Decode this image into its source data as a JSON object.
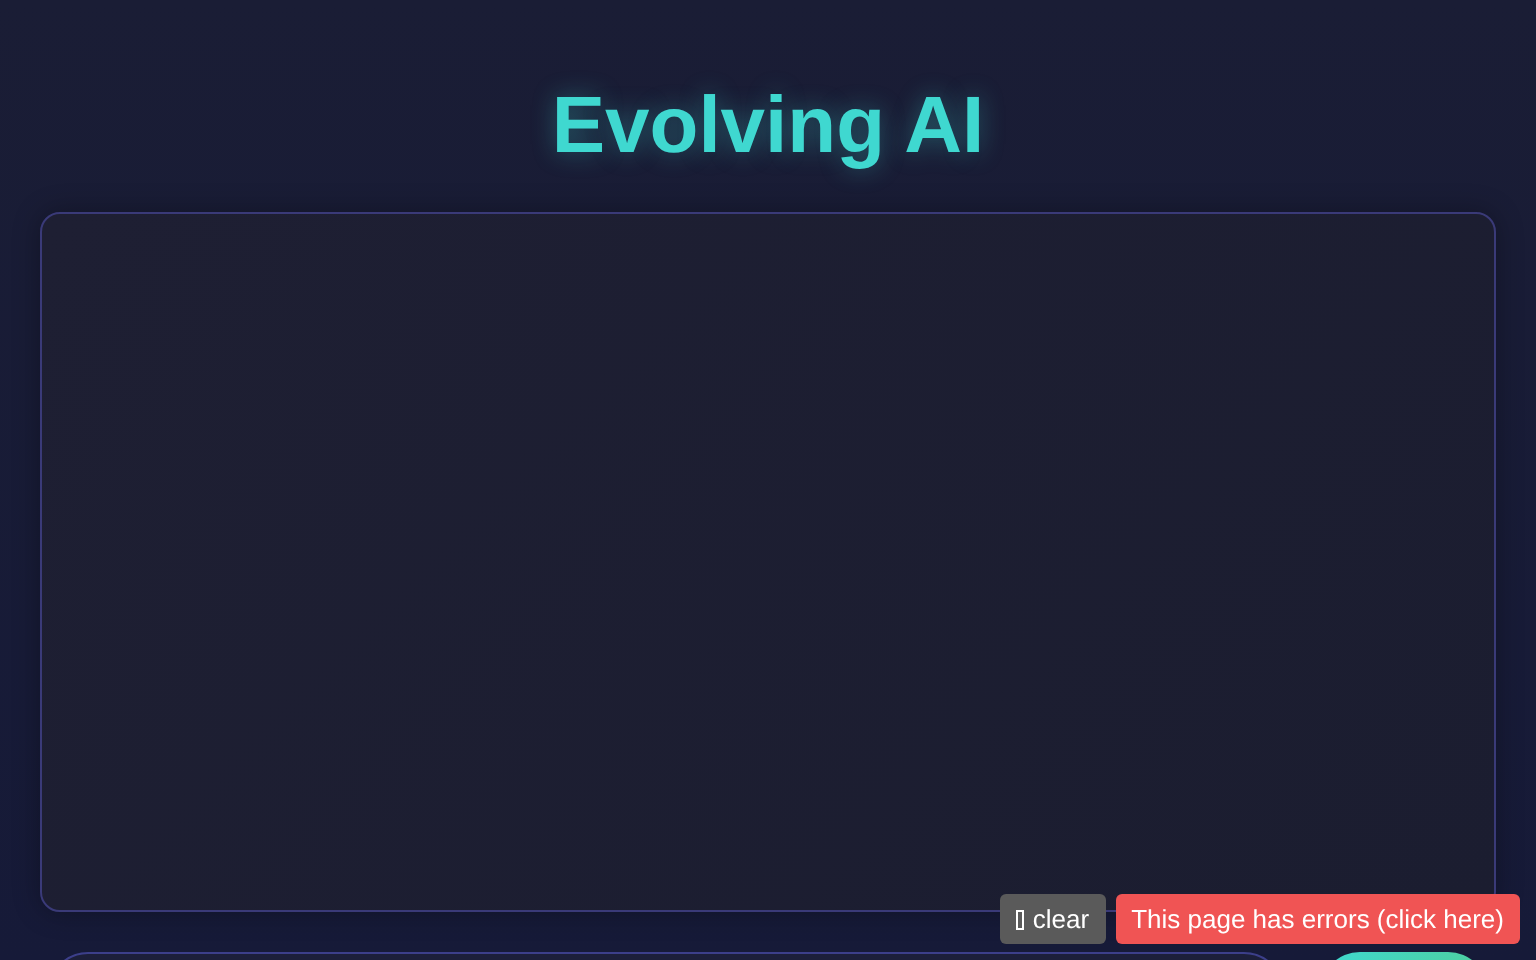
{
  "title": "Evolving AI",
  "console": {
    "clear_label": "clear",
    "error_message": "This page has errors (click here)"
  }
}
